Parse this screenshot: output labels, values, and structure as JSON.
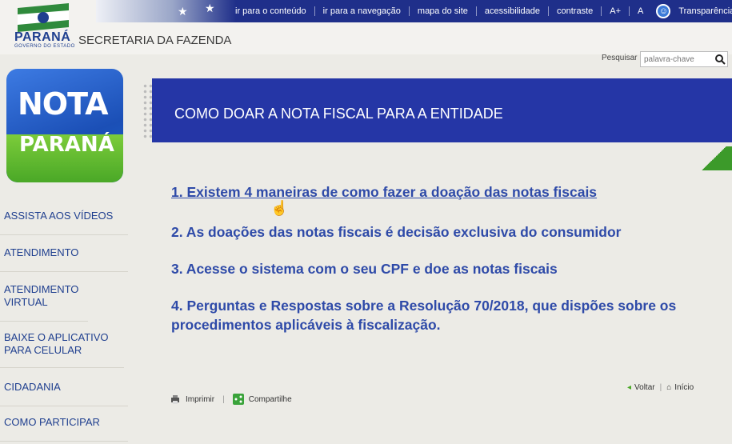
{
  "header": {
    "brand": "PARANÁ",
    "brand_sub": "GOVERNO DO ESTADO",
    "secretaria": "SECRETARIA DA FAZENDA",
    "nav_links": [
      "ir para o conteúdo",
      "ir para a navegação",
      "mapa do site",
      "acessibilidade",
      "contraste",
      "A+",
      "A",
      "Transparência"
    ],
    "search_label": "Pesquisar",
    "search_placeholder": "palavra-chave"
  },
  "sidebar": {
    "logo_line1": "NOTA",
    "logo_line2": "PARANÁ",
    "items": [
      "ASSISTA AOS VÍDEOS",
      "ATENDIMENTO",
      "ATENDIMENTO VIRTUAL",
      "BAIXE O APLICATIVO PARA CELULAR",
      "CIDADANIA",
      "COMO PARTICIPAR"
    ]
  },
  "main": {
    "title": "COMO DOAR A NOTA FISCAL PARA A ENTIDADE",
    "items": [
      "1. Existem 4 maneiras de como fazer a doação das notas fiscais",
      "2. As doações das notas fiscais é decisão exclusiva do consumidor",
      "3. Acesse o sistema com o seu CPF e doe as notas fiscais",
      "4. Perguntas e Respostas sobre a Resolução 70/2018, que dispões sobre os procedimentos aplicáveis à fiscalização."
    ]
  },
  "footer": {
    "print": "Imprimir",
    "share": "Compartilhe",
    "back": "Voltar",
    "home": "Início"
  },
  "colors": {
    "brand_blue": "#2536a6",
    "link_blue": "#2e4aa8",
    "green": "#4aa827"
  }
}
